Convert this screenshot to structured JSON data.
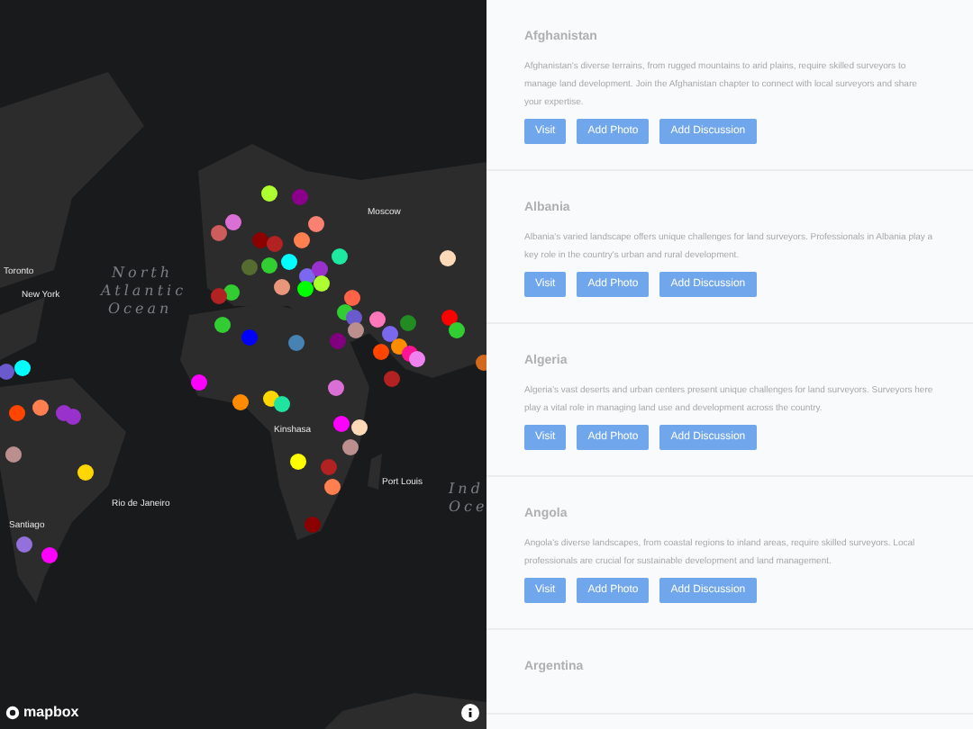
{
  "map": {
    "labels": [
      {
        "text": "Toronto",
        "kind": "city"
      },
      {
        "text": "New York",
        "kind": "city"
      },
      {
        "text": "North",
        "kind": "ocean"
      },
      {
        "text": "Atlantic",
        "kind": "ocean"
      },
      {
        "text": "Ocean",
        "kind": "ocean"
      },
      {
        "text": "Moscow",
        "kind": "city"
      },
      {
        "text": "Kinshasa",
        "kind": "city"
      },
      {
        "text": "Rio de Janeiro",
        "kind": "city"
      },
      {
        "text": "Port Louis",
        "kind": "city"
      },
      {
        "text": "Santiago",
        "kind": "city"
      },
      {
        "text": "Ind",
        "kind": "ocean"
      },
      {
        "text": "Oce",
        "kind": "ocean"
      }
    ],
    "markers": [
      {
        "color": "#adff2f"
      },
      {
        "color": "#8b008b"
      },
      {
        "color": "#da70d6"
      },
      {
        "color": "#cd5c5c"
      },
      {
        "color": "#fa8072"
      },
      {
        "color": "#8b0000"
      },
      {
        "color": "#b22222"
      },
      {
        "color": "#ff7f50"
      },
      {
        "color": "#1de9a0"
      },
      {
        "color": "#00ffff"
      },
      {
        "color": "#556b2f"
      },
      {
        "color": "#32cd32"
      },
      {
        "color": "#7b68ee"
      },
      {
        "color": "#9932cc"
      },
      {
        "color": "#e9967a"
      },
      {
        "color": "#00ff00"
      },
      {
        "color": "#adff2f"
      },
      {
        "color": "#32cd32"
      },
      {
        "color": "#b22222"
      },
      {
        "color": "#ffdab9"
      },
      {
        "color": "#ff6347"
      },
      {
        "color": "#32cd32"
      },
      {
        "color": "#6a5acd"
      },
      {
        "color": "#bc8f8f"
      },
      {
        "color": "#ff77bb"
      },
      {
        "color": "#228b22"
      },
      {
        "color": "#ff0000"
      },
      {
        "color": "#32cd32"
      },
      {
        "color": "#7b68ee"
      },
      {
        "color": "#ff4500"
      },
      {
        "color": "#ff8c00"
      },
      {
        "color": "#ff1493"
      },
      {
        "color": "#ee82ee"
      },
      {
        "color": "#800080"
      },
      {
        "color": "#b22222"
      },
      {
        "color": "#32cd32"
      },
      {
        "color": "#0000ff"
      },
      {
        "color": "#4682b4"
      },
      {
        "color": "#ff00ff"
      },
      {
        "color": "#da70d6"
      },
      {
        "color": "#ff8c00"
      },
      {
        "color": "#ffd700"
      },
      {
        "color": "#20e3a0"
      },
      {
        "color": "#ff00ff"
      },
      {
        "color": "#ffdab9"
      },
      {
        "color": "#bc8f8f"
      },
      {
        "color": "#ffff00"
      },
      {
        "color": "#b22222"
      },
      {
        "color": "#ff7f50"
      },
      {
        "color": "#8b0000"
      },
      {
        "color": "#00ffff"
      },
      {
        "color": "#6a5acd"
      },
      {
        "color": "#ff4500"
      },
      {
        "color": "#ff7f50"
      },
      {
        "color": "#9932cc"
      },
      {
        "color": "#9932cc"
      },
      {
        "color": "#bc8f8f"
      },
      {
        "color": "#ffd700"
      },
      {
        "color": "#d2691e"
      },
      {
        "color": "#9370db"
      },
      {
        "color": "#ff00ff"
      }
    ],
    "attribution": "mapbox"
  },
  "countries": [
    {
      "name": "Afghanistan",
      "description": "Afghanistan's diverse terrains, from rugged mountains to arid plains, require skilled surveyors to manage land development. Join the Afghanistan chapter to connect with local surveyors and share your expertise.",
      "buttons": [
        "Visit",
        "Add Photo",
        "Add Discussion"
      ]
    },
    {
      "name": "Albania",
      "description": "Albania's varied landscape offers unique challenges for land surveyors. Professionals in Albania play a key role in the country's urban and rural development.",
      "buttons": [
        "Visit",
        "Add Photo",
        "Add Discussion"
      ]
    },
    {
      "name": "Algeria",
      "description": "Algeria's vast deserts and urban centers present unique challenges for land surveyors. Surveyors here play a vital role in managing land use and development across the country.",
      "buttons": [
        "Visit",
        "Add Photo",
        "Add Discussion"
      ]
    },
    {
      "name": "Angola",
      "description": "Angola's diverse landscapes, from coastal regions to inland areas, require skilled surveyors. Local professionals are crucial for sustainable development and land management.",
      "buttons": [
        "Visit",
        "Add Photo",
        "Add Discussion"
      ]
    },
    {
      "name": "Argentina"
    }
  ]
}
